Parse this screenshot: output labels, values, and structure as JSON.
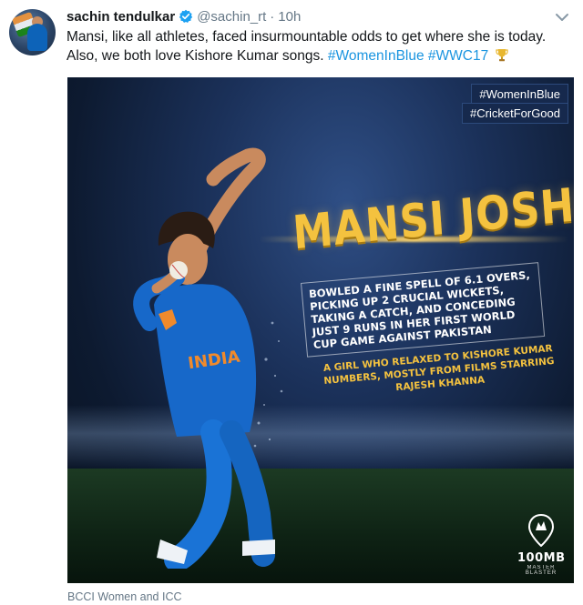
{
  "author": {
    "name": "sachin tendulkar",
    "handle": "@sachin_rt",
    "separator": "·",
    "time": "10h",
    "verified": true
  },
  "tweet": {
    "line1": "Mansi, like all athletes, faced insurmountable odds to get where she is today.",
    "line2_prefix": "Also, we both love Kishore Kumar songs.",
    "hashtag1": "#WomenInBlue",
    "hashtag2": "#WWC17"
  },
  "media": {
    "badge1": "#WomenInBlue",
    "badge2": "#CricketForGood",
    "player_name": "MANSI JOSHI",
    "stat": "Bowled a fine spell of 6.1 overs, picking up 2 crucial wickets, taking a catch, and conceding just 9 runs in her first World Cup game against Pakistan",
    "fun_fact": "A girl who relaxed to Kishore Kumar numbers, mostly from films starring Rajesh Khanna",
    "jersey_text": "INDIA",
    "brand_name": "100MB",
    "brand_sub": "MASTER BLASTER"
  },
  "credit": "BCCI Women and ICC",
  "colors": {
    "link": "#1b95e0",
    "muted": "#657786",
    "gold": "#f4c23f",
    "jersey": "#1768c9"
  },
  "icons": {
    "verified": "verified-badge-icon",
    "trophy": "trophy-icon",
    "caret": "chevron-down-icon",
    "brand": "map-pin-logo-icon"
  }
}
